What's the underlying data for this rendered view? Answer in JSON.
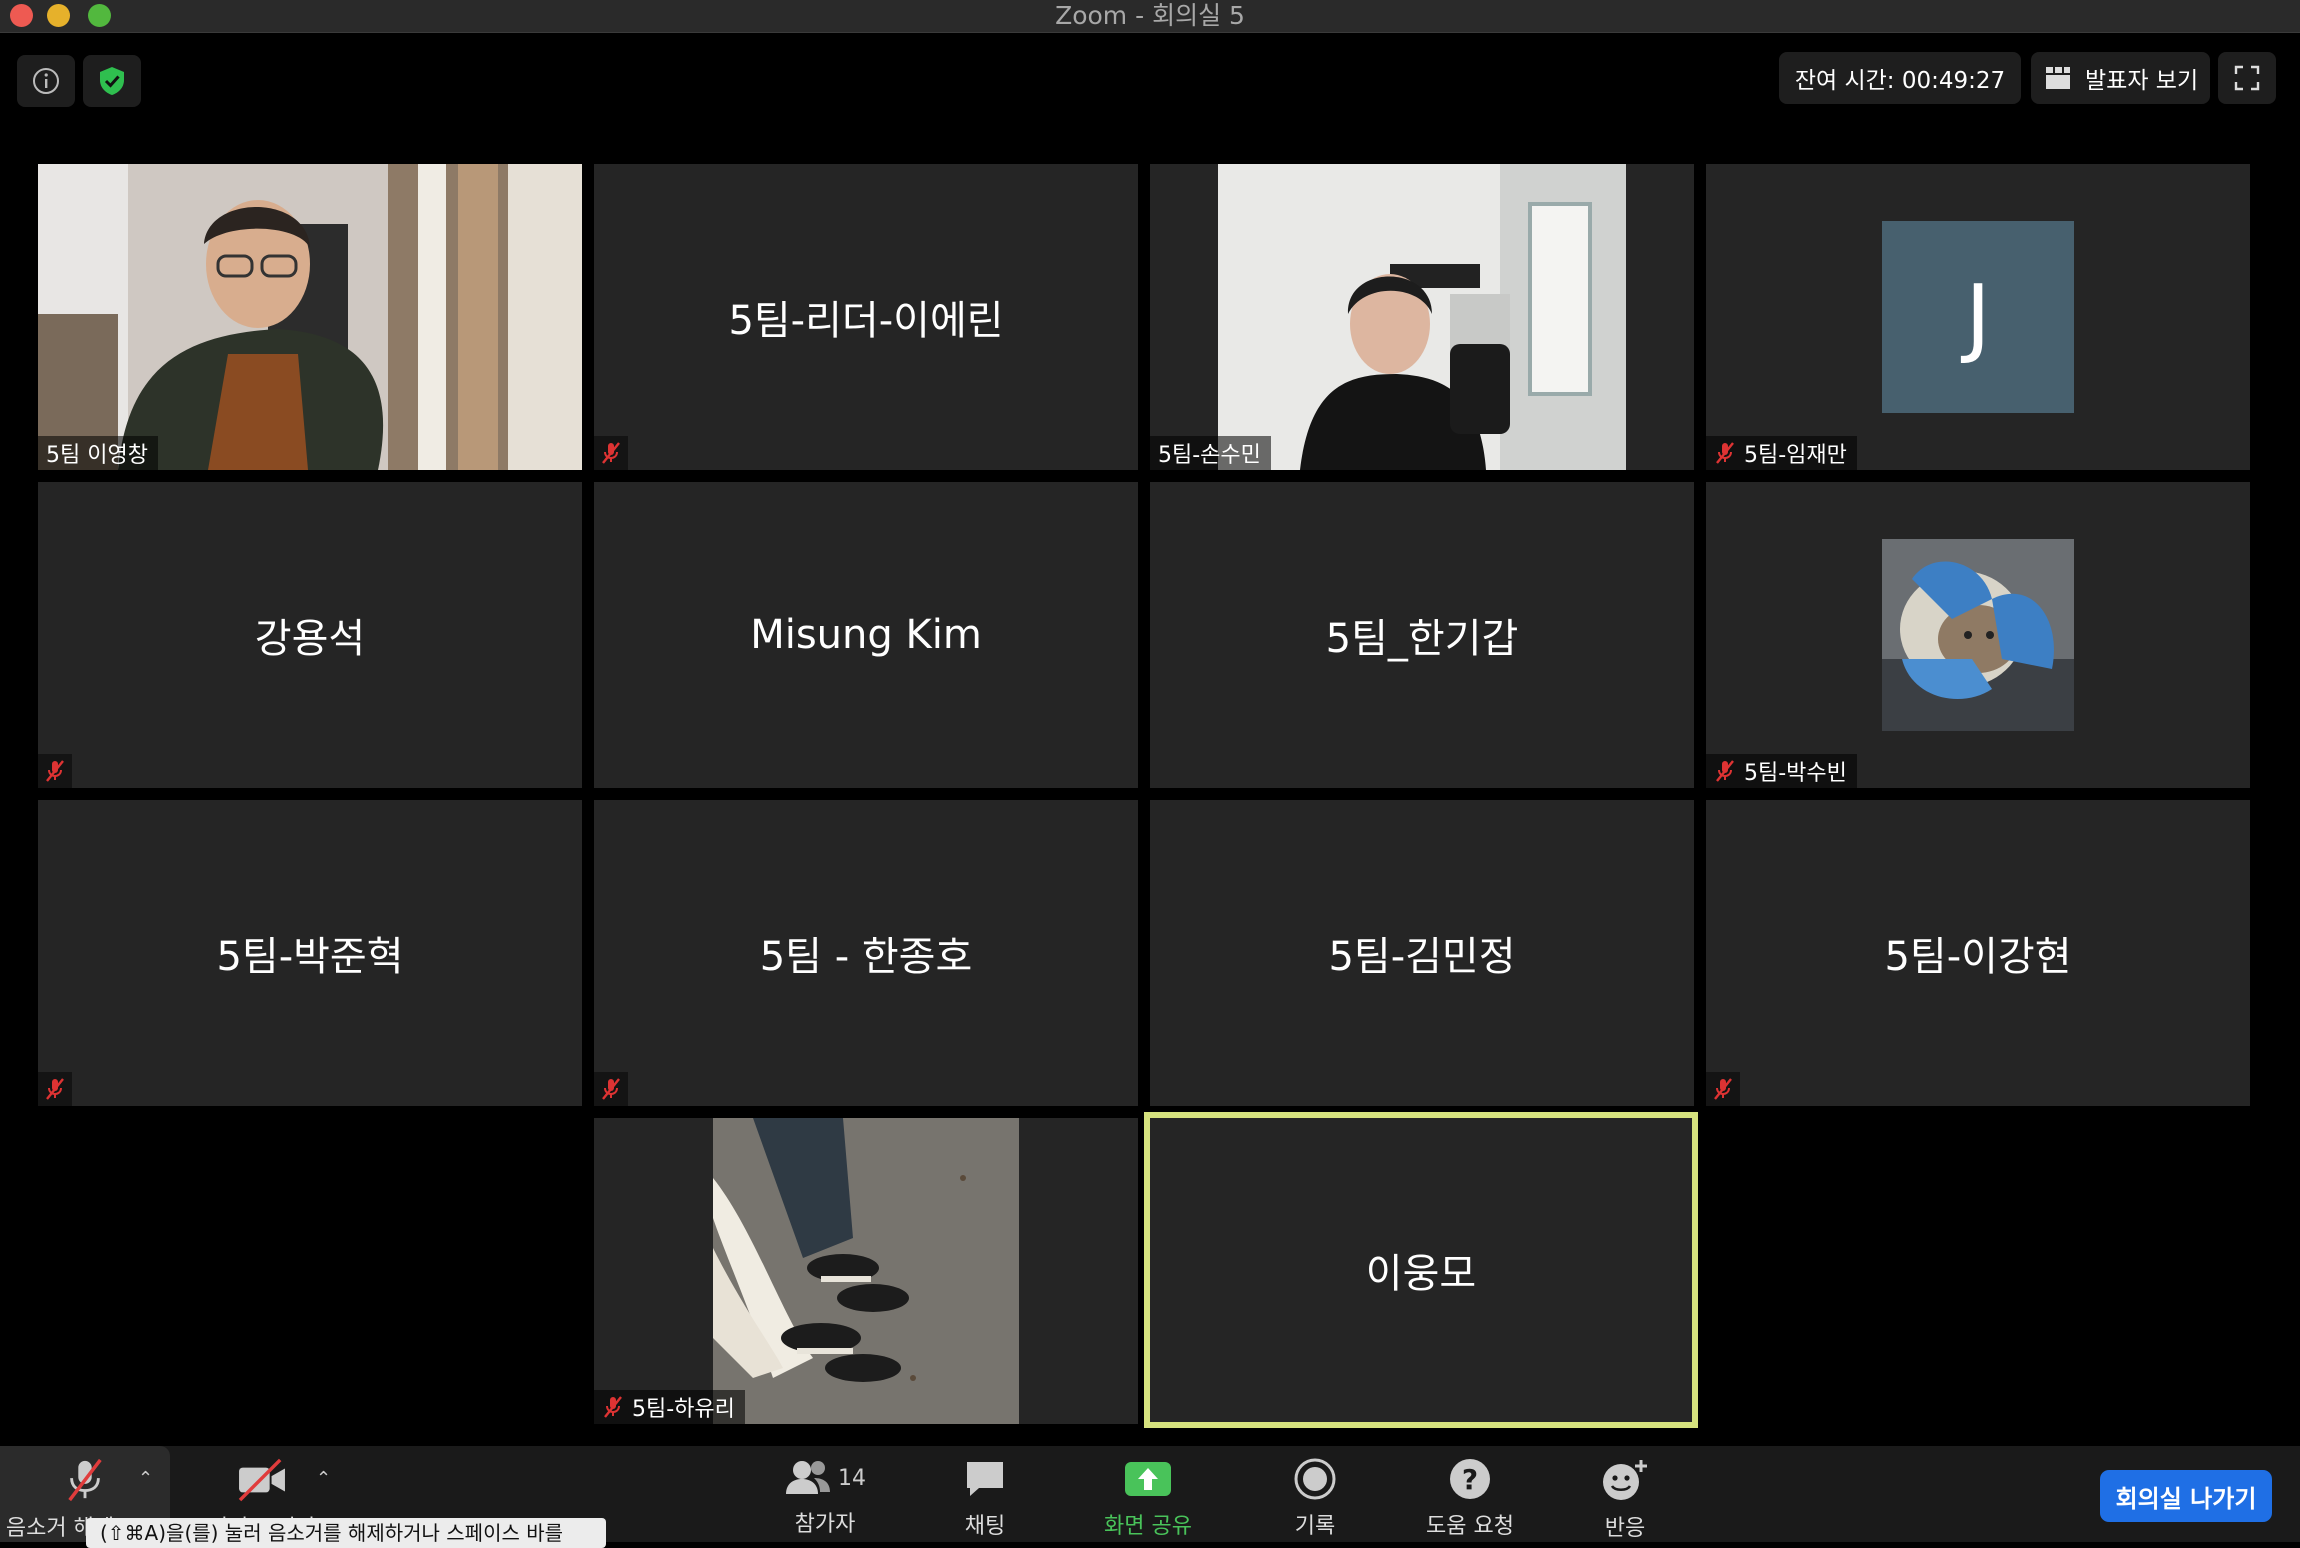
{
  "window": {
    "title": "Zoom - 회의실 5"
  },
  "top": {
    "timer": "잔여 시간: 00:49:27",
    "speaker_view": "발표자 보기"
  },
  "participants": [
    {
      "name": "5팀 이영창",
      "muted": false,
      "video": "person-webcam"
    },
    {
      "name": "5팀-리더-이에린",
      "muted": true
    },
    {
      "name": "5팀-손수민",
      "muted": false,
      "video": "person-webcam"
    },
    {
      "name": "5팀-임재만",
      "muted": true,
      "avatar_letter": "J"
    },
    {
      "name": "강용석",
      "muted": true
    },
    {
      "name": "Misung Kim",
      "muted": false
    },
    {
      "name": "5팀_한기갑",
      "muted": false
    },
    {
      "name": "5팀-박수빈",
      "muted": true,
      "avatar": "puppy-photo"
    },
    {
      "name": "5팀-박준혁",
      "muted": true
    },
    {
      "name": "5팀 - 한종호",
      "muted": true
    },
    {
      "name": "5팀-김민정",
      "muted": false
    },
    {
      "name": "5팀-이강현",
      "muted": true
    },
    {
      "name": "5팀-하유리",
      "muted": true,
      "avatar": "sneakers-photo"
    },
    {
      "name": "이웅모",
      "muted": false,
      "speaking": true
    }
  ],
  "toolbar": {
    "mute": "음소거 해제",
    "video": "비디오 시작",
    "participants": "참가자",
    "participants_count": "14",
    "chat": "채팅",
    "share": "화면 공유",
    "record": "기록",
    "help": "도움 요청",
    "reactions": "반응",
    "leave": "회의실 나가기"
  },
  "tooltip": "(⇧⌘A)을(를) 눌러 음소거를 해제하거나 스페이스 바를",
  "colors": {
    "speaking_border": "#d6e27e",
    "share_green": "#49c35a",
    "leave_blue": "#1f6fe5",
    "avatar_slate": "#47606e"
  }
}
